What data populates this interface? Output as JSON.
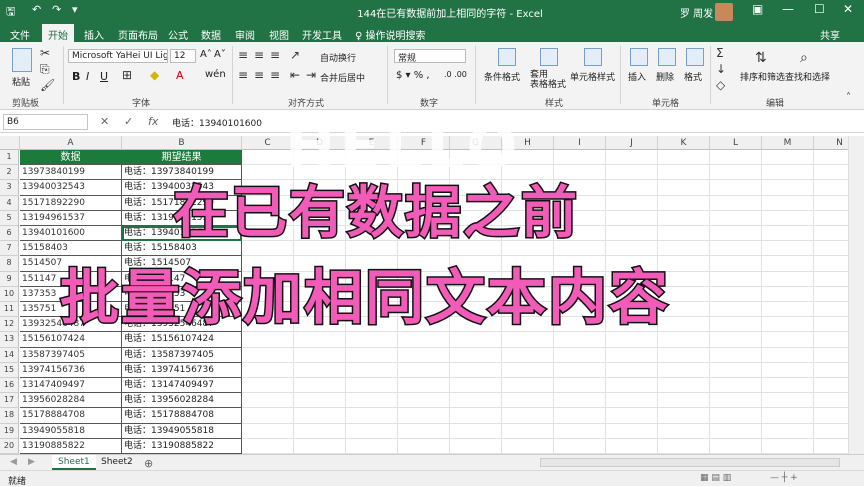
{
  "titlebar": {
    "quick_access": [
      "🖫",
      "↶",
      "↷",
      "▾"
    ],
    "title": "144在已有数据前加上相同的字符 - Excel",
    "user": "罗 周发",
    "window_controls": [
      "▣",
      "—",
      "☐",
      "✕"
    ]
  },
  "ribbon_tabs": [
    "文件",
    "开始",
    "插入",
    "页面布局",
    "公式",
    "数据",
    "审阅",
    "视图",
    "开发工具",
    "♀ 操作说明搜索"
  ],
  "share_label": "共享",
  "ribbon": {
    "paste_label": "粘贴",
    "clipboard_label": "剪贴板",
    "font_name": "Microsoft YaHei UI Ligh",
    "font_size": "12",
    "font_label": "字体",
    "wrap_text": "自动换行",
    "merge_center": "合并后居中",
    "alignment_label": "对齐方式",
    "number_format": "常规",
    "number_label": "数字",
    "conditional_format": "条件格式",
    "format_as_table": "套用\n表格格式",
    "cell_styles": "单元格样式",
    "styles_label": "样式",
    "insert": "插入",
    "delete": "删除",
    "format": "格式",
    "cells_label": "单元格",
    "sort_filter": "排序和筛选",
    "find_select": "查找和选择",
    "editing_label": "编辑"
  },
  "formula_bar": {
    "name_box": "B6",
    "formula": "电话：13940101600"
  },
  "columns": [
    "A",
    "B",
    "C",
    "D",
    "E",
    "F",
    "G",
    "H",
    "I",
    "J",
    "K",
    "L",
    "M",
    "N",
    "O"
  ],
  "headers": {
    "a": "数据",
    "b": "期望结果"
  },
  "rows": [
    {
      "n": "1"
    },
    {
      "n": "2",
      "a": "13973840199",
      "b": "电话：13973840199"
    },
    {
      "n": "3",
      "a": "13940032543",
      "b": "电话：13940032543"
    },
    {
      "n": "4",
      "a": "15171892290",
      "b": "电话：15171892290"
    },
    {
      "n": "5",
      "a": "13194961537",
      "b": "电话：13194961537"
    },
    {
      "n": "6",
      "a": "13940101600",
      "b": "电话：13940101600"
    },
    {
      "n": "7",
      "a": "15158403",
      "b": "电话：15158403"
    },
    {
      "n": "8",
      "a": "1514507",
      "b": "电话：1514507"
    },
    {
      "n": "9",
      "a": "151147",
      "b": "电话：151147"
    },
    {
      "n": "10",
      "a": "137353",
      "b": "电话：137353"
    },
    {
      "n": "11",
      "a": "135751",
      "b": "电话：135751"
    },
    {
      "n": "12",
      "a": "13932546487",
      "b": "电话：13932546487"
    },
    {
      "n": "13",
      "a": "15156107424",
      "b": "电话：15156107424"
    },
    {
      "n": "14",
      "a": "13587397405",
      "b": "电话：13587397405"
    },
    {
      "n": "15",
      "a": "13974156736",
      "b": "电话：13974156736"
    },
    {
      "n": "16",
      "a": "13147409497",
      "b": "电话：13147409497"
    },
    {
      "n": "17",
      "a": "13956028284",
      "b": "电话：13956028284"
    },
    {
      "n": "18",
      "a": "15178884708",
      "b": "电话：15178884708"
    },
    {
      "n": "19",
      "a": "13949055818",
      "b": "电话：13949055818"
    },
    {
      "n": "20",
      "a": "13190885822",
      "b": "电话：13190885822"
    }
  ],
  "sheets": [
    "Sheet1",
    "Sheet2"
  ],
  "status": {
    "ready": "就绪"
  },
  "overlay": {
    "line1": "在已有数据之前",
    "line2": "批量添加相同文本内容",
    "ghost": "HELLO"
  },
  "colors": {
    "excel_green": "#217346",
    "header_green": "#1c7a3a",
    "overlay_pink": "#f25bb8"
  }
}
